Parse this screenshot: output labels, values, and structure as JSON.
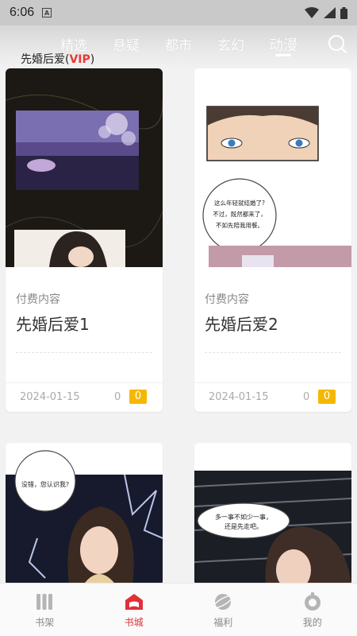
{
  "status_bar": {
    "time": "6:06",
    "app_icon_letter": "A",
    "icons": [
      "wifi-icon",
      "signal-icon",
      "battery-icon"
    ]
  },
  "header": {
    "tabs": [
      {
        "label": "精选"
      },
      {
        "label": "悬疑"
      },
      {
        "label": "都市"
      },
      {
        "label": "玄幻"
      },
      {
        "label": "动漫",
        "active": true
      }
    ],
    "search_icon": "search-icon"
  },
  "section": {
    "title": "先婚后爱",
    "vip_open": "(",
    "vip": "VIP",
    "vip_close": ")"
  },
  "books": [
    {
      "paid_label": "付费内容",
      "title": "先婚后爱1",
      "date": "2024-01-15",
      "count": "0",
      "badge": "0"
    },
    {
      "paid_label": "付费内容",
      "title": "先婚后爱2",
      "date": "2024-01-15",
      "count": "0",
      "badge": "0"
    },
    {
      "bubble_line1": "没错，",
      "bubble_line2": "您认识我?"
    },
    {
      "bubble_line1": "多一事不如少一事，",
      "bubble_line2": "还是先走吧。"
    }
  ],
  "card2_bubble": {
    "line1": "这么年轻就结婚了?",
    "line2": "不过，既然都来了，",
    "line3": "不如先陪我用餐。"
  },
  "bottom_nav": [
    {
      "label": "书架",
      "icon": "bookshelf-icon"
    },
    {
      "label": "书城",
      "icon": "bookstore-icon",
      "active": true
    },
    {
      "label": "福利",
      "icon": "planet-icon"
    },
    {
      "label": "我的",
      "icon": "profile-icon"
    }
  ],
  "colors": {
    "accent": "#e0303a",
    "vip": "#e53935",
    "badge": "#f5b800"
  }
}
